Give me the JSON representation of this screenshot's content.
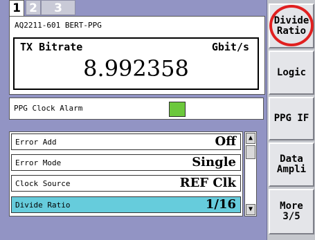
{
  "tabs": [
    {
      "label": "1"
    },
    {
      "label": "2"
    },
    {
      "label": "3"
    }
  ],
  "device": {
    "name": "AQ2211-601 BERT-PPG",
    "bitrate_label": "TX Bitrate",
    "bitrate_unit": "Gbit/s",
    "bitrate_value": "8.992358"
  },
  "alarm": {
    "label": "PPG Clock Alarm",
    "color": "#6cc83c"
  },
  "settings": [
    {
      "label": "Error Add",
      "value": "Off"
    },
    {
      "label": "Error Mode",
      "value": "Single"
    },
    {
      "label": "Clock Source",
      "value": "REF Clk"
    },
    {
      "label": "Divide Ratio",
      "value": "1/16"
    }
  ],
  "scrollbar": {
    "up_icon": "▲",
    "down_icon": "▼"
  },
  "softkeys": [
    {
      "label": "Divide\nRatio"
    },
    {
      "label": "Logic"
    },
    {
      "label": "PPG IF"
    },
    {
      "label": "Data\nAmpli"
    },
    {
      "label": "More\n3/5"
    }
  ],
  "colors": {
    "panel_bg": "#9294c4",
    "selected_row": "#66ccdc",
    "highlight_ring": "#e02020"
  }
}
